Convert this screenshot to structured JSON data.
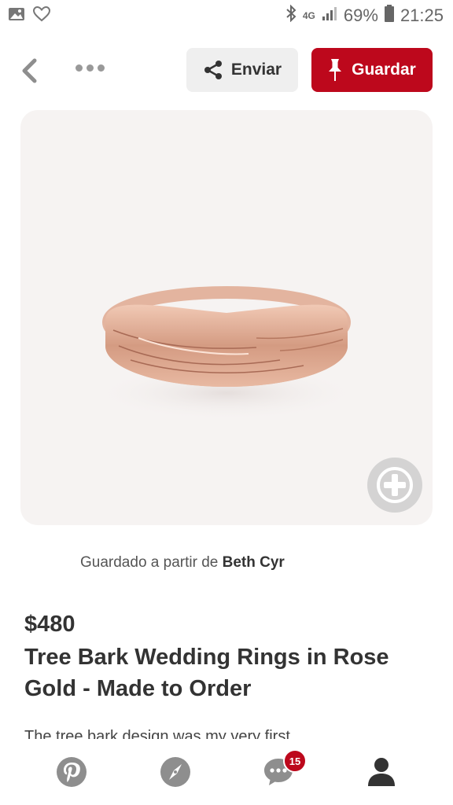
{
  "status_bar": {
    "network": "4G",
    "battery": "69%",
    "time": "21:25"
  },
  "topbar": {
    "send_label": "Enviar",
    "save_label": "Guardar"
  },
  "pin": {
    "attribution_prefix": "Guardado a partir de",
    "attribution_source": "Beth Cyr",
    "price": "$480",
    "title": "Tree Bark Wedding Rings in Rose Gold - Made to Order",
    "description": "The tree bark design was my very first"
  },
  "bottom_nav": {
    "notifications_count": "15"
  },
  "colors": {
    "brand_red": "#bd081c",
    "icon_gray": "#8e8e8e"
  }
}
